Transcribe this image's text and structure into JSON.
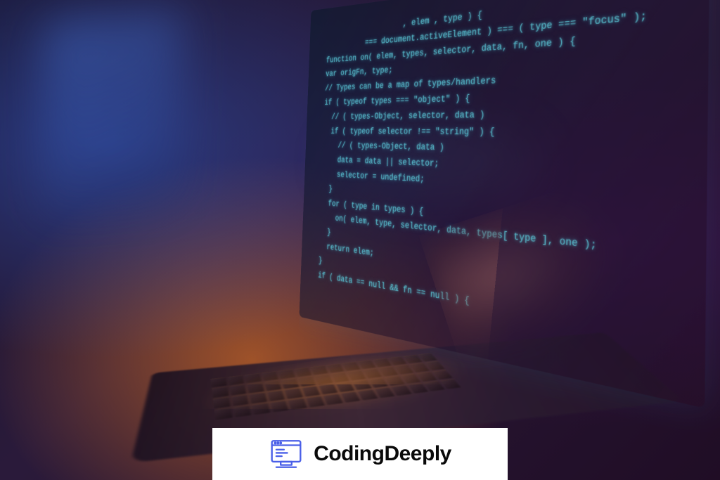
{
  "scene": {
    "description": "Dark moody photo of a laptop viewed from the side at a low angle, with floating semi-transparent code displayed on/above the screen. Warm orange keyboard backlight glow, blurred blue monitor in background, a hand resting on the trackpad area.",
    "code_lines": [
      "                   , elem , type ) {",
      "          === document.activeElement ) === ( type === \"focus\" );",
      "",
      "function on( elem, types, selector, data, fn, one ) {",
      "var origFn, type;",
      "",
      "// Types can be a map of types/handlers",
      "if ( typeof types === \"object\" ) {",
      "",
      "  // ( types-Object, selector, data )",
      "  if ( typeof selector !== \"string\" ) {",
      "",
      "    // ( types-Object, data )",
      "    data = data || selector;",
      "    selector = undefined;",
      "  }",
      "  for ( type in types ) {",
      "    on( elem, type, selector, data, types[ type ], one );",
      "  }",
      "  return elem;",
      "}",
      "",
      "if ( data == null && fn == null ) {"
    ]
  },
  "logo": {
    "brand_text": "CodingDeeply",
    "icon_name": "computer-code-icon",
    "icon_color": "#4a5fe8"
  }
}
